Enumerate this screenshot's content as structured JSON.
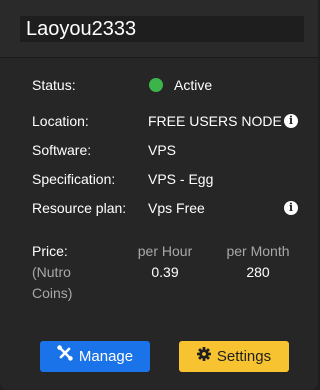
{
  "server": {
    "name": "Laoyou2333"
  },
  "details": {
    "status_label": "Status:",
    "status_value": "Active",
    "status_color": "#3bb54a",
    "location_label": "Location:",
    "location_value": "FREE USERS NODE",
    "software_label": "Software:",
    "software_value": "VPS",
    "specification_label": "Specification:",
    "specification_value": "VPS - Egg",
    "resource_plan_label": "Resource plan:",
    "resource_plan_value": "Vps Free"
  },
  "price": {
    "label": "Price:",
    "unit_line1": "(Nutro",
    "unit_line2": "Coins)",
    "per_hour_label": "per Hour",
    "per_hour_value": "0.39",
    "per_month_label": "per Month",
    "per_month_value": "280"
  },
  "actions": {
    "manage_label": "Manage",
    "manage_icon": "tools-icon",
    "manage_color": "#1a73e8",
    "settings_label": "Settings",
    "settings_icon": "gear-icon",
    "settings_color": "#f8c330"
  }
}
